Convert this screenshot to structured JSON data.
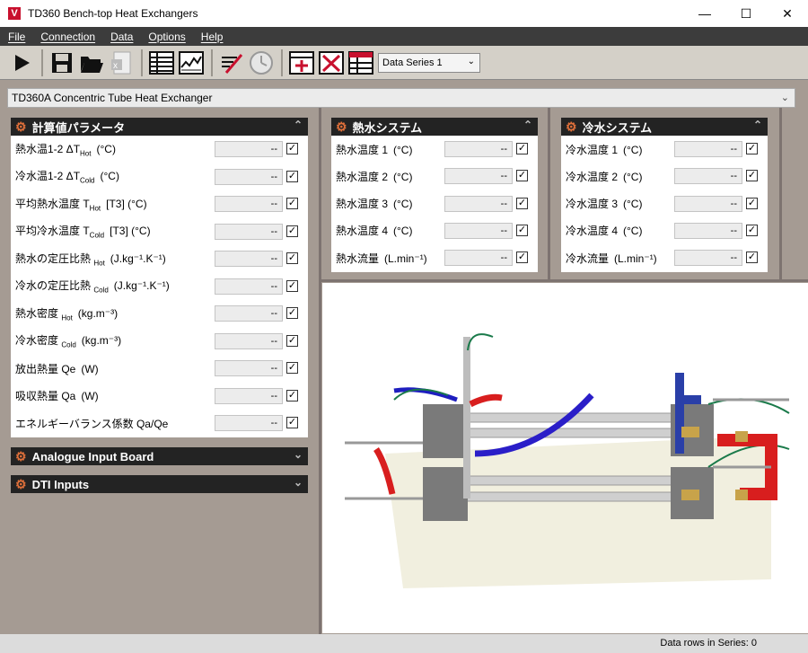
{
  "app": {
    "logo": "V",
    "title": "TD360 Bench-top Heat Exchangers"
  },
  "window_controls": {
    "minimize": "—",
    "maximize": "☐",
    "close": "✕"
  },
  "menu": [
    "File",
    "Connection",
    "Data",
    "Options",
    "Help"
  ],
  "toolbar": {
    "icons": [
      "play-icon",
      "save-icon",
      "open-folder-icon",
      "export-excel-icon",
      "table-icon",
      "chart-icon",
      "edit-chart-icon",
      "clock-icon",
      "add-series-icon",
      "delete-series-icon",
      "series-table-icon"
    ],
    "series_select": "Data Series 1"
  },
  "exchanger_select": "TD360A Concentric Tube Heat Exchanger",
  "calc_panel": {
    "title": "計算値パラメータ",
    "rows": [
      {
        "label": "熱水温1-2 ΔT",
        "sub": "Hot",
        "tail": "(°C)",
        "value": "--"
      },
      {
        "label": "冷水温1-2 ΔT",
        "sub": "Cold",
        "tail": "(°C)",
        "value": "--"
      },
      {
        "label": "平均熱水温度 T",
        "sub": "Hot",
        "tail": "[T3]  (°C)",
        "value": "--"
      },
      {
        "label": "平均冷水温度 T",
        "sub": "Cold",
        "tail": "[T3]  (°C)",
        "value": "--"
      },
      {
        "label": "熱水の定圧比熱 ",
        "sub": "Hot",
        "tail": "(J.kg⁻¹.K⁻¹)",
        "value": "--"
      },
      {
        "label": "冷水の定圧比熱 ",
        "sub": "Cold",
        "tail": "(J.kg⁻¹.K⁻¹)",
        "value": "--"
      },
      {
        "label": "熱水密度 ",
        "sub": "Hot",
        "tail": "(kg.m⁻³)",
        "value": "--"
      },
      {
        "label": "冷水密度 ",
        "sub": "Cold",
        "tail": "(kg.m⁻³)",
        "value": "--"
      },
      {
        "label": "放出熱量 Qe",
        "sub": "",
        "tail": "(W)",
        "value": "--"
      },
      {
        "label": "吸収熱量 Qa",
        "sub": "",
        "tail": "(W)",
        "value": "--"
      },
      {
        "label": "エネルギーバランス係数 Qa/Qe",
        "sub": "",
        "tail": "",
        "value": "--"
      }
    ]
  },
  "hot_panel": {
    "title": "熱水システム",
    "rows": [
      {
        "label": "熱水温度 1",
        "tail": "(°C)",
        "value": "--"
      },
      {
        "label": "熱水温度 2",
        "tail": "(°C)",
        "value": "--"
      },
      {
        "label": "熱水温度 3",
        "tail": "(°C)",
        "value": "--"
      },
      {
        "label": "熱水温度 4",
        "tail": "(°C)",
        "value": "--"
      },
      {
        "label": "熱水流量",
        "tail": "(L.min⁻¹)",
        "value": "--"
      }
    ]
  },
  "cold_panel": {
    "title": "冷水システム",
    "rows": [
      {
        "label": "冷水温度 1",
        "tail": "(°C)",
        "value": "--"
      },
      {
        "label": "冷水温度 2",
        "tail": "(°C)",
        "value": "--"
      },
      {
        "label": "冷水温度 3",
        "tail": "(°C)",
        "value": "--"
      },
      {
        "label": "冷水温度 4",
        "tail": "(°C)",
        "value": "--"
      },
      {
        "label": "冷水流量",
        "tail": "(L.min⁻¹)",
        "value": "--"
      }
    ]
  },
  "analogue_bar": "Analogue Input Board",
  "dti_bar": "DTI Inputs",
  "status": "Data rows in Series: 0",
  "colors": {
    "header": "#232323",
    "gear": "#e0703a",
    "menu": "#3c3c3c",
    "background": "#a59b93"
  }
}
